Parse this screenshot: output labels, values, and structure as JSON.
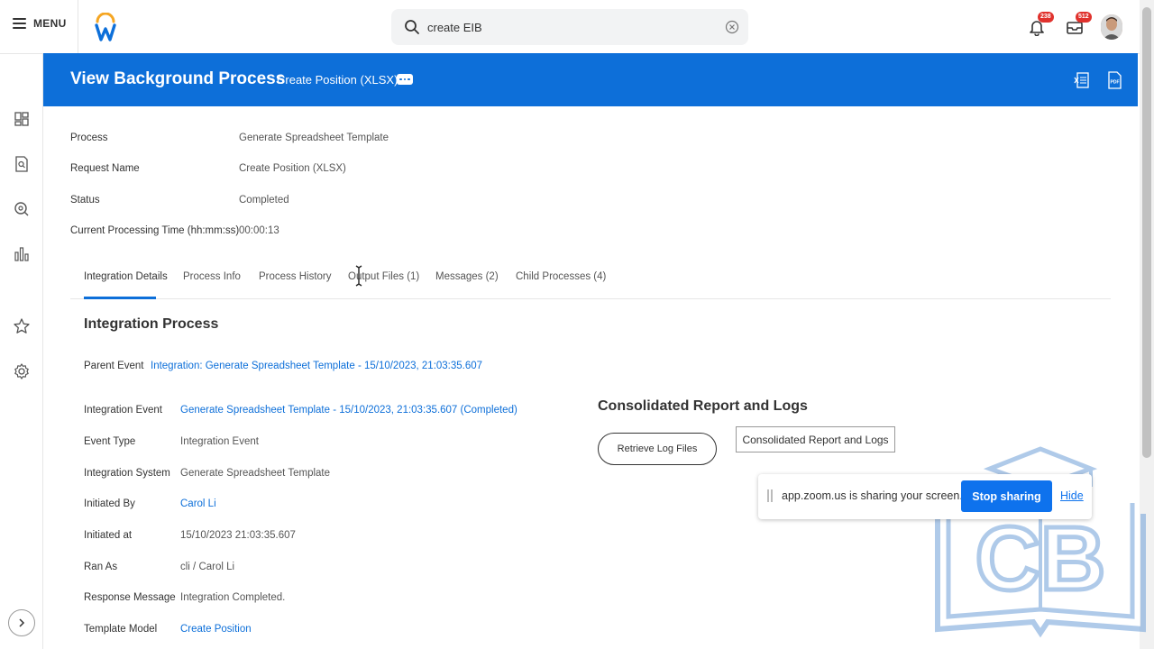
{
  "topbar": {
    "menu_label": "MENU",
    "search_value": "create EIB",
    "notifications_count": "238",
    "inbox_count": "512"
  },
  "header": {
    "title": "View Background Process",
    "subtitle": "Create Position (XLSX)"
  },
  "summary": [
    {
      "label": "Process",
      "value": "Generate Spreadsheet Template"
    },
    {
      "label": "Request Name",
      "value": "Create Position (XLSX)"
    },
    {
      "label": "Status",
      "value": "Completed"
    },
    {
      "label": "Current Processing Time (hh:mm:ss)",
      "value": "00:00:13"
    }
  ],
  "tabs": [
    {
      "label": "Integration Details",
      "active": true
    },
    {
      "label": "Process Info",
      "active": false
    },
    {
      "label": "Process History",
      "active": false
    },
    {
      "label": "Output Files (1)",
      "active": false
    },
    {
      "label": "Messages (2)",
      "active": false
    },
    {
      "label": "Child Processes (4)",
      "active": false
    }
  ],
  "integration": {
    "section_title": "Integration Process",
    "parent_event_label": "Parent Event",
    "parent_event_value": "Integration: Generate Spreadsheet Template - 15/10/2023, 21:03:35.607",
    "rows": [
      {
        "label": "Integration Event",
        "value": "Generate Spreadsheet Template - 15/10/2023, 21:03:35.607 (Completed)",
        "link": true
      },
      {
        "label": "Event Type",
        "value": "Integration Event",
        "link": false
      },
      {
        "label": "Integration System",
        "value": "Generate Spreadsheet Template",
        "link": false
      },
      {
        "label": "Initiated By",
        "value": "Carol Li",
        "link": true
      },
      {
        "label": "Initiated at",
        "value": "15/10/2023 21:03:35.607",
        "link": false
      },
      {
        "label": "Ran As",
        "value": "cli / Carol Li",
        "link": false
      },
      {
        "label": "Response Message",
        "value": "Integration Completed.",
        "link": false
      },
      {
        "label": "Template Model",
        "value": "Create Position",
        "link": true
      }
    ]
  },
  "consolidated": {
    "title": "Consolidated Report and Logs",
    "retrieve_label": "Retrieve Log Files",
    "tooltip": "Consolidated Report and Logs"
  },
  "zoom": {
    "message": "app.zoom.us is sharing your screen.",
    "stop_label": "Stop sharing",
    "hide_label": "Hide"
  },
  "watermark": {
    "text": "CB"
  },
  "colors": {
    "brand_blue": "#0d6fd9",
    "zoom_blue": "#0e72ed",
    "badge_red": "#e0322d"
  }
}
